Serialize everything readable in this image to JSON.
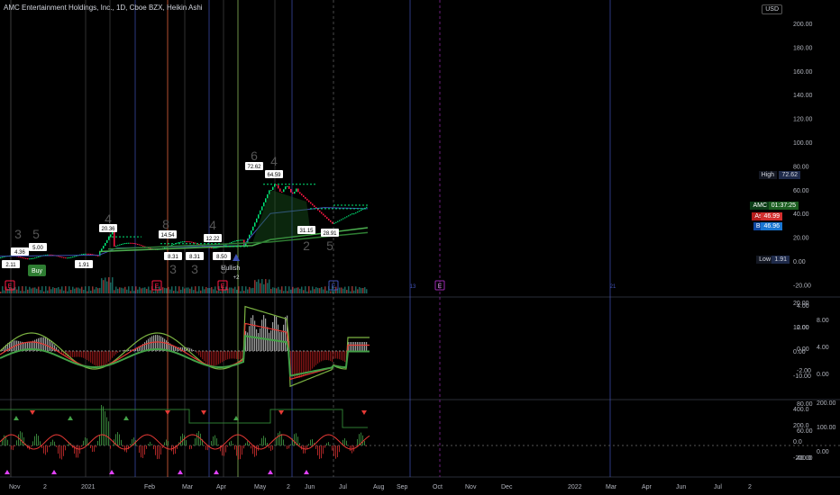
{
  "header": {
    "title": "AMC Entertainment Holdings, Inc., 1D, Cboe BZX, Heikin Ashi",
    "currency_button": "USD"
  },
  "price_axis": [
    "200.00",
    "180.00",
    "160.00",
    "140.00",
    "120.00",
    "100.00",
    "80.00",
    "60.00",
    "40.00",
    "20.00",
    "0.00",
    "-20.00"
  ],
  "osc1_axis": [
    "20.00",
    "10.00",
    "0.00",
    "-10.00"
  ],
  "osc1_right_axis": [
    "4.00",
    "2.00",
    "0.00",
    "-2.00"
  ],
  "osc1_far_axis": [
    "8.00",
    "4.00",
    "0.00"
  ],
  "osc2_axis": [
    "400.0",
    "200.0",
    "0.0",
    "-200.0"
  ],
  "osc2_right_axis": [
    "80.00",
    "60.00",
    "40.00"
  ],
  "osc2_far_axis": [
    "200.00",
    "100.00",
    "0.00"
  ],
  "time_axis": [
    "Nov",
    "2",
    "2021",
    "Feb",
    "Mar",
    "Apr",
    "May",
    "2",
    "Jun",
    "Jul",
    "Aug",
    "Sep",
    "Oct",
    "Nov",
    "Dec",
    "2022",
    "Mar",
    "Apr",
    "Jun",
    "Jul",
    "2"
  ],
  "price_tags": {
    "high_label": "High",
    "high_value": "72.62",
    "symbol": "AMC",
    "countdown": "01:37:25",
    "ask_label": "Ask",
    "ask_value": "46.99",
    "bid_label": "Bid",
    "bid_value": "46.96",
    "low_label": "Low",
    "low_value": "1.91"
  },
  "annotations": {
    "pivot_labels": [
      "2.11",
      "4.36",
      "5.00",
      "1.91",
      "20.36",
      "14.54",
      "12.22",
      "8.31",
      "8.31",
      "8.50",
      "72.62",
      "64.59",
      "31.15",
      "28.91"
    ],
    "buy_signal": "Buy",
    "bullish_text": "Bullish",
    "bullish_sub": "+2",
    "wave_counts": [
      "3",
      "5",
      "4",
      "8",
      "4",
      "6",
      "4",
      "3",
      "3",
      "5",
      "2",
      "5"
    ],
    "event_markers": [
      "E",
      "E",
      "E",
      "E",
      "E"
    ],
    "dividend_markers": [
      "13",
      "21"
    ]
  },
  "colors": {
    "background": "#000000",
    "up": "#26a69a",
    "green": "#00e676",
    "red": "#ff1744",
    "blue_line": "#3f51b5",
    "purple": "#9c27b0"
  }
}
